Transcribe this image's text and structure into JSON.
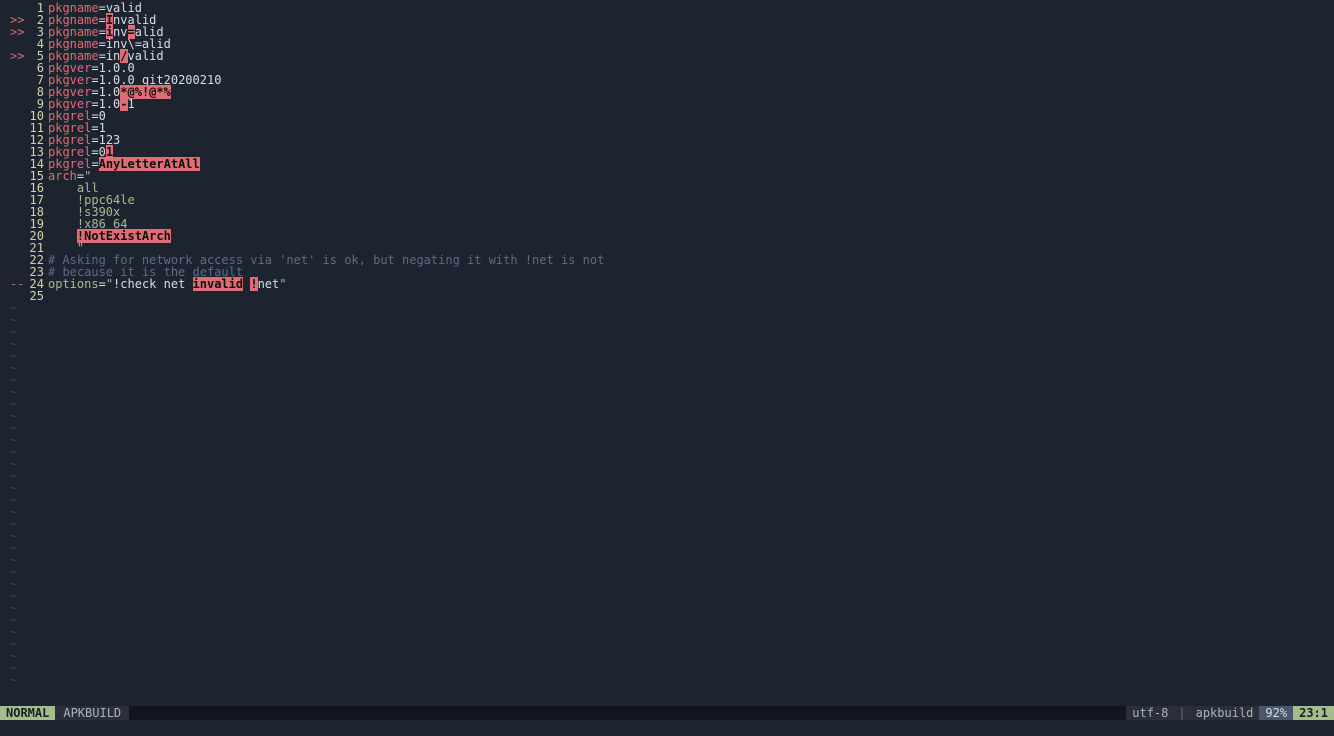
{
  "signs": {
    "warn": ">>",
    "hint": "--"
  },
  "lines": [
    {
      "n": "1",
      "sign": "",
      "parts": [
        [
          "kw",
          "pkgname"
        ],
        [
          "eq",
          "="
        ],
        [
          "str",
          "valid"
        ]
      ]
    },
    {
      "n": "2",
      "sign": "warn",
      "parts": [
        [
          "kw",
          "pkgname"
        ],
        [
          "eq",
          "="
        ],
        [
          "err",
          "I"
        ],
        [
          "str",
          "nvalid"
        ]
      ]
    },
    {
      "n": "3",
      "sign": "warn",
      "parts": [
        [
          "kw",
          "pkgname"
        ],
        [
          "eq",
          "="
        ],
        [
          "err",
          "i"
        ],
        [
          "str",
          "nv"
        ],
        [
          "err",
          "="
        ],
        [
          "str",
          "alid"
        ]
      ]
    },
    {
      "n": "4",
      "sign": "",
      "parts": [
        [
          "kw",
          "pkgname"
        ],
        [
          "eq",
          "="
        ],
        [
          "str",
          "inv\\=alid"
        ]
      ]
    },
    {
      "n": "5",
      "sign": "warn",
      "parts": [
        [
          "kw",
          "pkgname"
        ],
        [
          "eq",
          "="
        ],
        [
          "str",
          "in"
        ],
        [
          "err",
          "/"
        ],
        [
          "str",
          "valid"
        ]
      ]
    },
    {
      "n": "6",
      "sign": "",
      "parts": [
        [
          "kw",
          "pkgver"
        ],
        [
          "eq",
          "="
        ],
        [
          "str",
          "1.0.0"
        ]
      ]
    },
    {
      "n": "7",
      "sign": "",
      "parts": [
        [
          "kw",
          "pkgver"
        ],
        [
          "eq",
          "="
        ],
        [
          "str",
          "1.0.0_git20200210"
        ]
      ]
    },
    {
      "n": "8",
      "sign": "",
      "parts": [
        [
          "kw",
          "pkgver"
        ],
        [
          "eq",
          "="
        ],
        [
          "str",
          "1.0"
        ],
        [
          "errtxt",
          "*@%!@*%"
        ]
      ]
    },
    {
      "n": "9",
      "sign": "",
      "parts": [
        [
          "kw",
          "pkgver"
        ],
        [
          "eq",
          "="
        ],
        [
          "str",
          "1.0"
        ],
        [
          "errtxt",
          "-"
        ],
        [
          "str",
          "1"
        ]
      ]
    },
    {
      "n": "10",
      "sign": "",
      "parts": [
        [
          "kw",
          "pkgrel"
        ],
        [
          "eq",
          "="
        ],
        [
          "str",
          "0"
        ]
      ]
    },
    {
      "n": "11",
      "sign": "",
      "parts": [
        [
          "kw",
          "pkgrel"
        ],
        [
          "eq",
          "="
        ],
        [
          "str",
          "1"
        ]
      ]
    },
    {
      "n": "12",
      "sign": "",
      "parts": [
        [
          "kw",
          "pkgrel"
        ],
        [
          "eq",
          "="
        ],
        [
          "str",
          "123"
        ]
      ]
    },
    {
      "n": "13",
      "sign": "",
      "parts": [
        [
          "kw",
          "pkgrel"
        ],
        [
          "eq",
          "="
        ],
        [
          "str",
          "0"
        ],
        [
          "errtxt",
          "1"
        ]
      ]
    },
    {
      "n": "14",
      "sign": "",
      "parts": [
        [
          "kw",
          "pkgrel"
        ],
        [
          "eq",
          "="
        ],
        [
          "errtxt",
          "AnyLetterAtAll"
        ]
      ]
    },
    {
      "n": "15",
      "sign": "",
      "parts": [
        [
          "kw",
          "arch"
        ],
        [
          "eq",
          "="
        ],
        [
          "green",
          "\""
        ]
      ]
    },
    {
      "n": "16",
      "sign": "",
      "parts": [
        [
          "green",
          "    all"
        ]
      ]
    },
    {
      "n": "17",
      "sign": "",
      "parts": [
        [
          "green",
          "    !ppc64le"
        ]
      ]
    },
    {
      "n": "18",
      "sign": "",
      "parts": [
        [
          "green",
          "    !s390x"
        ]
      ]
    },
    {
      "n": "19",
      "sign": "",
      "parts": [
        [
          "green",
          "    !x86_64"
        ]
      ]
    },
    {
      "n": "20",
      "sign": "",
      "parts": [
        [
          "green",
          "    "
        ],
        [
          "errtxt",
          "!NotExistArch"
        ]
      ]
    },
    {
      "n": "21",
      "sign": "",
      "parts": [
        [
          "green",
          "    \""
        ]
      ]
    },
    {
      "n": "22",
      "sign": "",
      "parts": [
        [
          "comment",
          "# Asking for network access via 'net' is ok, but negating it with !net is not"
        ]
      ]
    },
    {
      "n": "23",
      "sign": "",
      "parts": [
        [
          "comment",
          "# because it is the default"
        ]
      ]
    },
    {
      "n": "24",
      "sign": "hint",
      "parts": [
        [
          "options-kw",
          "options"
        ],
        [
          "eq",
          "="
        ],
        [
          "green",
          "\""
        ],
        [
          "str",
          "!check net "
        ],
        [
          "errtxt",
          "invalid"
        ],
        [
          "str",
          " "
        ],
        [
          "errtxt",
          "!"
        ],
        [
          "str",
          "net"
        ],
        [
          "green",
          "\""
        ]
      ]
    },
    {
      "n": "25",
      "sign": "",
      "parts": []
    }
  ],
  "tilde": "~",
  "tilde_count": 32,
  "status": {
    "mode": "NORMAL",
    "filename": "APKBUILD",
    "encoding": "utf-8",
    "filetype": "apkbuild",
    "percent": "92%",
    "position": "23:1"
  }
}
